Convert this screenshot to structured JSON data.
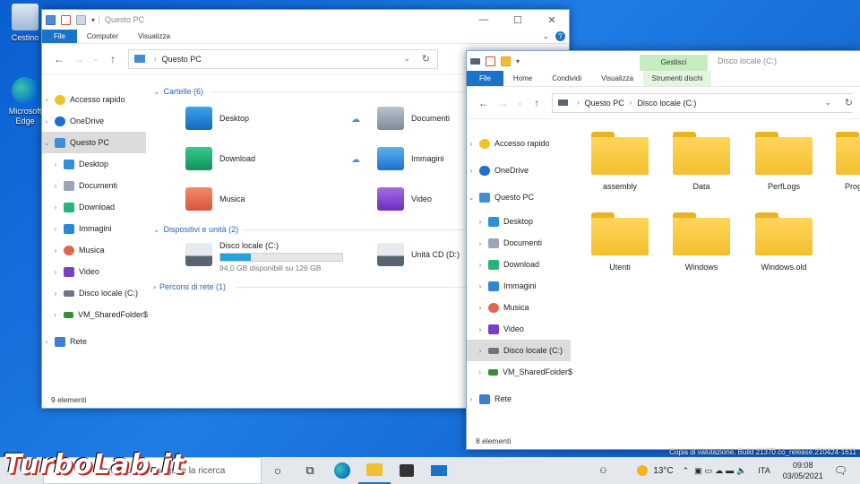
{
  "desktop": {
    "icons": [
      {
        "label": "Cestino"
      },
      {
        "label": "Microsoft Edge"
      }
    ]
  },
  "window1": {
    "title": "Questo PC",
    "ribbon_tabs": [
      "File",
      "Computer",
      "Visualizza"
    ],
    "breadcrumb": [
      "Questo PC"
    ],
    "nav_items": [
      {
        "label": "Accesso rapido",
        "icon": "star-icon"
      },
      {
        "label": "OneDrive",
        "icon": "cloud-icon"
      },
      {
        "label": "Questo PC",
        "icon": "pc-icon"
      },
      {
        "label": "Desktop",
        "icon": "desktop-icon"
      },
      {
        "label": "Documenti",
        "icon": "documents-icon"
      },
      {
        "label": "Download",
        "icon": "download-icon"
      },
      {
        "label": "Immagini",
        "icon": "pictures-icon"
      },
      {
        "label": "Musica",
        "icon": "music-icon"
      },
      {
        "label": "Video",
        "icon": "video-icon"
      },
      {
        "label": "Disco locale (C:)",
        "icon": "drive-icon"
      },
      {
        "label": "VM_SharedFolder$",
        "icon": "network-drive-icon"
      },
      {
        "label": "Rete",
        "icon": "network-icon"
      }
    ],
    "groups": {
      "folders": "Cartelle (6)",
      "devices": "Dispositivi e unità (2)",
      "network": "Percorsi di rete (1)"
    },
    "folders": [
      {
        "label": "Desktop"
      },
      {
        "label": "Documenti"
      },
      {
        "label": "Download"
      },
      {
        "label": "Immagini"
      },
      {
        "label": "Musica"
      },
      {
        "label": "Video"
      }
    ],
    "drives": [
      {
        "label": "Disco locale (C:)",
        "space": "94,0 GB disponibili su 126 GB",
        "used_fraction": 0.25
      },
      {
        "label": "Unità CD (D:)"
      }
    ],
    "status": "9 elementi"
  },
  "window2": {
    "title": "Disco locale (C:)",
    "ribbon_tabs": [
      "File",
      "Home",
      "Condividi",
      "Visualizza",
      "Strumenti dischi"
    ],
    "context_tab": "Gestisci",
    "breadcrumb": [
      "Questo PC",
      "Disco locale (C:)"
    ],
    "nav_items": [
      {
        "label": "Accesso rapido"
      },
      {
        "label": "OneDrive"
      },
      {
        "label": "Questo PC"
      },
      {
        "label": "Desktop"
      },
      {
        "label": "Documenti"
      },
      {
        "label": "Download"
      },
      {
        "label": "Immagini"
      },
      {
        "label": "Musica"
      },
      {
        "label": "Video"
      },
      {
        "label": "Disco locale (C:)"
      },
      {
        "label": "VM_SharedFolder$"
      },
      {
        "label": "Rete"
      }
    ],
    "folders": [
      "assembly",
      "Data",
      "PerfLogs",
      "Prog",
      "Utenti",
      "Windows",
      "Windows.old"
    ],
    "status": "8 elementi"
  },
  "taskbar": {
    "search_text": "Scrivi qui per eseguire la ricerca",
    "weather": "13°C",
    "lang": "ITA",
    "time": "09:08",
    "date": "03/05/2021"
  },
  "watermark": "Copia di valutazione. Build 21370.co_release.210424-1611",
  "logo_text": "TurboLab.it",
  "colors": {
    "accent": "#1a73c8",
    "context": "#c6ecc0",
    "folder": "#f4bf2f"
  }
}
